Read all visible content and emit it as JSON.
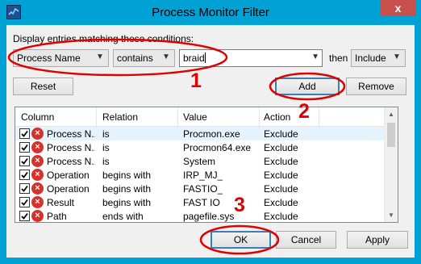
{
  "window": {
    "title": "Process Monitor Filter",
    "close_label": "x"
  },
  "condition": {
    "instruction": "Display entries matching these conditions:",
    "column_selected": "Process Name",
    "relation_selected": "contains",
    "value_text": "braid",
    "then_label": "then",
    "action_selected": "Include"
  },
  "buttons": {
    "reset": "Reset",
    "add": "Add",
    "remove": "Remove",
    "ok": "OK",
    "cancel": "Cancel",
    "apply": "Apply"
  },
  "table": {
    "headers": [
      "Column",
      "Relation",
      "Value",
      "Action"
    ],
    "rows": [
      {
        "column": "Process N...",
        "relation": "is",
        "value": "Procmon.exe",
        "action": "Exclude",
        "checked": true
      },
      {
        "column": "Process N...",
        "relation": "is",
        "value": "Procmon64.exe",
        "action": "Exclude",
        "checked": true
      },
      {
        "column": "Process N...",
        "relation": "is",
        "value": "System",
        "action": "Exclude",
        "checked": true
      },
      {
        "column": "Operation",
        "relation": "begins with",
        "value": "IRP_MJ_",
        "action": "Exclude",
        "checked": true
      },
      {
        "column": "Operation",
        "relation": "begins with",
        "value": "FASTIO_",
        "action": "Exclude",
        "checked": true
      },
      {
        "column": "Result",
        "relation": "begins with",
        "value": "FAST IO",
        "action": "Exclude",
        "checked": true
      },
      {
        "column": "Path",
        "relation": "ends with",
        "value": "pagefile.sys",
        "action": "Exclude",
        "checked": true
      }
    ]
  },
  "annotations": {
    "step1": "1",
    "step2": "2",
    "step3": "3",
    "color": "#e00000"
  },
  "colors": {
    "titlebar": "#00a2d6",
    "close_button": "#c7504c",
    "exclude_icon": "#d9302a"
  }
}
